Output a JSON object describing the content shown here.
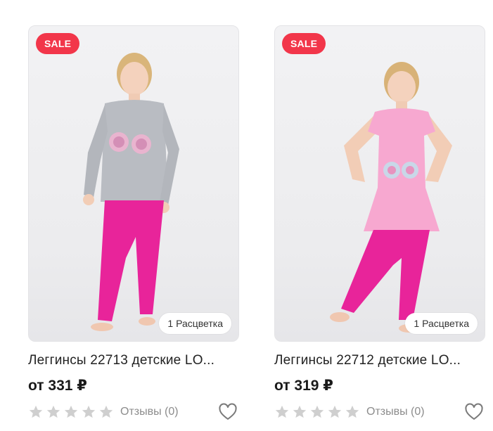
{
  "products": [
    {
      "badge": "SALE",
      "colors_label": "1 Расцветка",
      "title": "Леггинсы 22713 детские LO...",
      "price": "от 331 ₽",
      "reviews": "Отзывы (0)",
      "rating": 0,
      "favorite_icon": "heart-outline-icon",
      "star_icon": "star-icon",
      "top_color": "#b9bcc2",
      "bottom_color": "#e8249a"
    },
    {
      "badge": "SALE",
      "colors_label": "1 Расцветка",
      "title": "Леггинсы 22712 детские LO...",
      "price": "от 319 ₽",
      "reviews": "Отзывы (0)",
      "rating": 0,
      "favorite_icon": "heart-outline-icon",
      "star_icon": "star-icon",
      "top_color": "#f7a8d0",
      "bottom_color": "#e8249a"
    }
  ],
  "colors": {
    "sale_badge": "#f2364a",
    "star_empty": "#cfcfcf",
    "muted_text": "#8c8c8c"
  }
}
